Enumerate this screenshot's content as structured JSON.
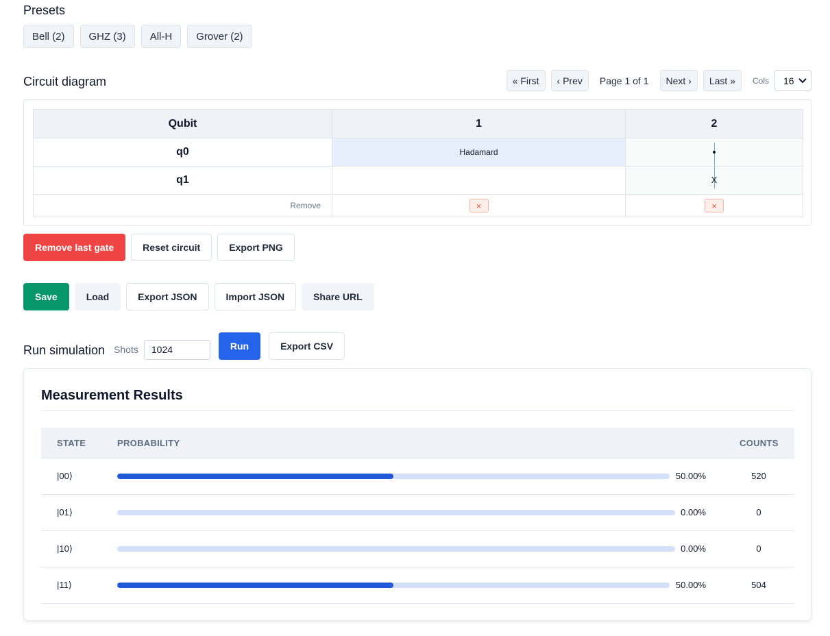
{
  "presets": {
    "title": "Presets",
    "items": [
      "Bell (2)",
      "GHZ (3)",
      "All-H",
      "Grover (2)"
    ]
  },
  "circuit": {
    "title": "Circuit diagram",
    "pager": {
      "first": "« First",
      "prev": "‹ Prev",
      "info": "Page 1 of 1",
      "next": "Next ›",
      "last": "Last »",
      "cols_label": "Cols",
      "cols_value": "16"
    },
    "headers": [
      "Qubit",
      "1",
      "2"
    ],
    "qubits": [
      {
        "label": "q0",
        "col1": "Hadamard",
        "col2": "•"
      },
      {
        "label": "q1",
        "col1": "",
        "col2": "X"
      }
    ],
    "remove_label": "Remove",
    "remove_icon": "×"
  },
  "actions_1": {
    "remove_last_gate": "Remove last gate",
    "reset_circuit": "Reset circuit",
    "export_png": "Export PNG"
  },
  "actions_2": {
    "save": "Save",
    "load": "Load",
    "export_json": "Export JSON",
    "import_json": "Import JSON",
    "share_url": "Share URL"
  },
  "simulation": {
    "title": "Run simulation",
    "shots_label": "Shots",
    "shots_value": "1024",
    "run": "Run",
    "export_csv": "Export CSV"
  },
  "results": {
    "title": "Measurement Results",
    "columns": {
      "state": "STATE",
      "probability": "PROBABILITY",
      "counts": "COUNTS"
    },
    "rows": [
      {
        "state": "|00⟩",
        "probability": 0.5,
        "pct": "50.00%",
        "counts": "520"
      },
      {
        "state": "|01⟩",
        "probability": 0.0,
        "pct": "0.00%",
        "counts": "0"
      },
      {
        "state": "|10⟩",
        "probability": 0.0,
        "pct": "0.00%",
        "counts": "0"
      },
      {
        "state": "|11⟩",
        "probability": 0.5,
        "pct": "50.00%",
        "counts": "504"
      }
    ]
  },
  "colors": {
    "danger": "#ef4444",
    "success": "#059669",
    "primary": "#2563eb",
    "bar_fill": "#2058d8",
    "bar_track": "#d3e0f7"
  }
}
